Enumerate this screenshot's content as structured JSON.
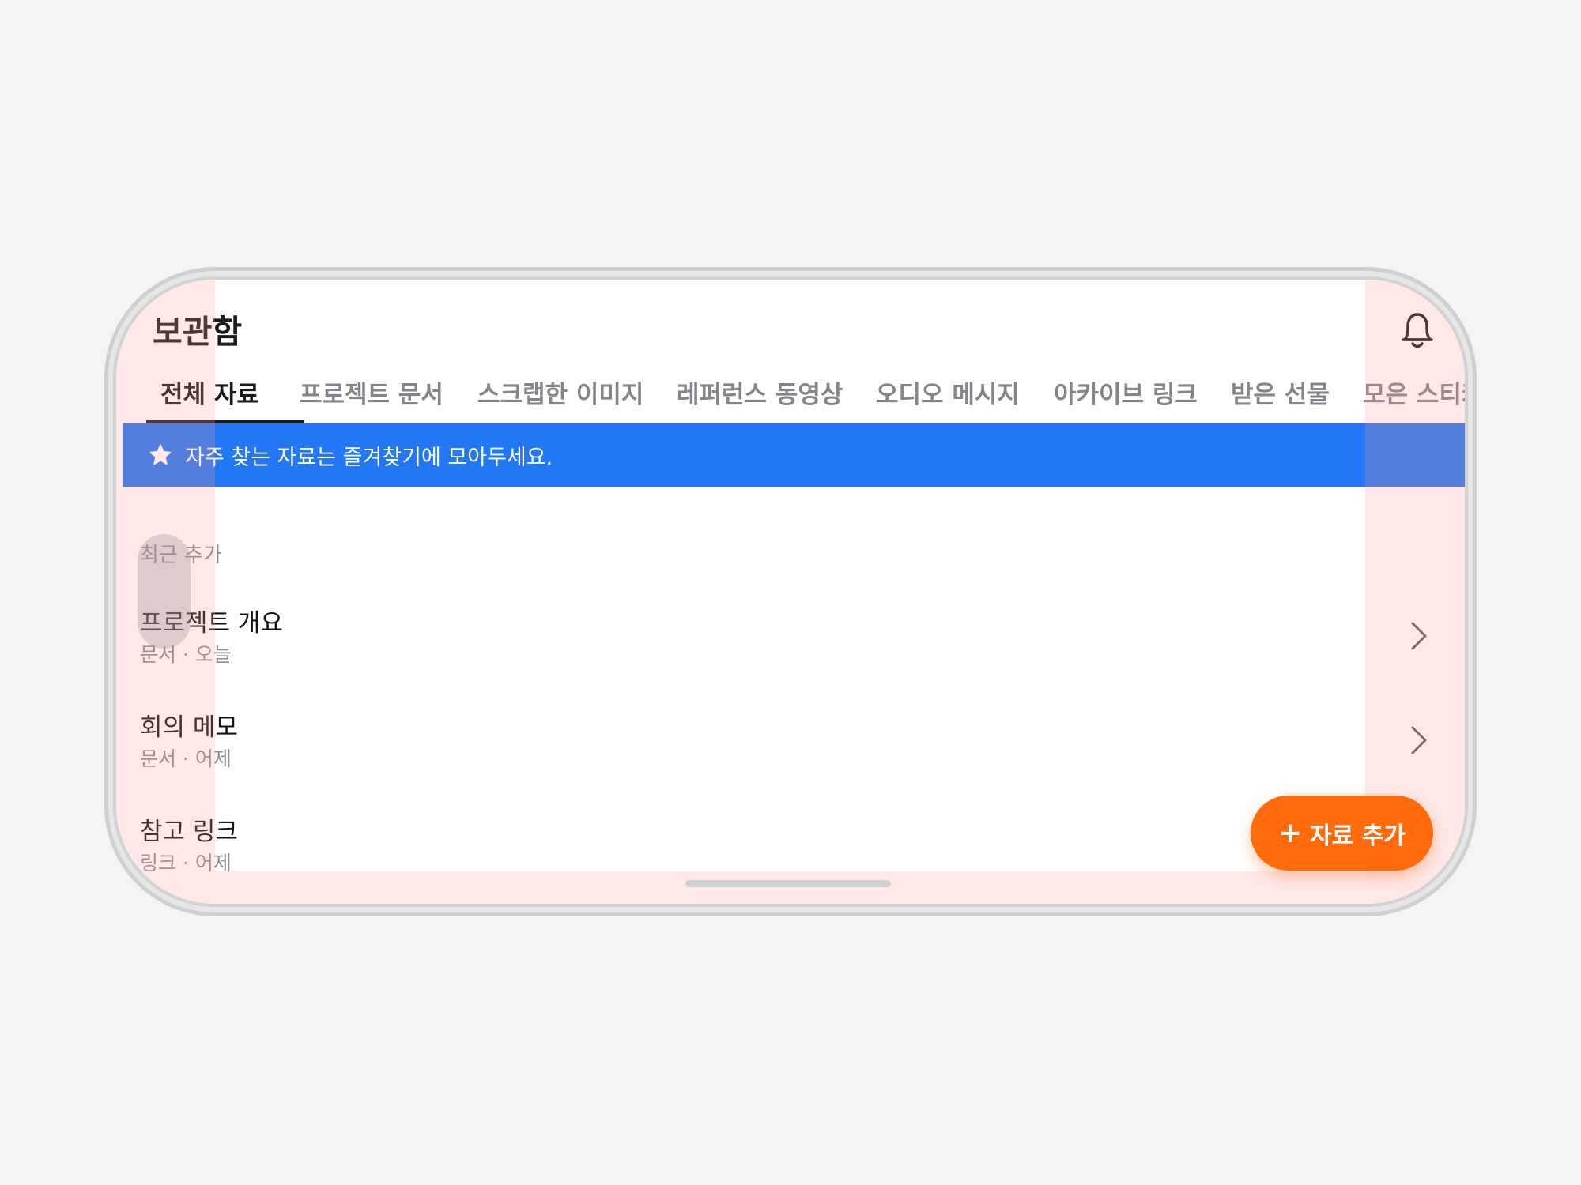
{
  "header": {
    "title": "보관함",
    "notification_icon": "bell-icon"
  },
  "tabs": [
    {
      "label": "전체 자료",
      "active": true
    },
    {
      "label": "프로젝트 문서",
      "active": false
    },
    {
      "label": "스크랩한 이미지",
      "active": false
    },
    {
      "label": "레퍼런스 동영상",
      "active": false
    },
    {
      "label": "오디오 메시지",
      "active": false
    },
    {
      "label": "아카이브 링크",
      "active": false
    },
    {
      "label": "받은 선물",
      "active": false
    },
    {
      "label": "모은 스티커",
      "active": false
    }
  ],
  "banner": {
    "icon": "star-icon",
    "text": "자주 찾는 자료는 즐겨찾기에 모아두세요.",
    "color": "#2378f5"
  },
  "section": {
    "label": "최근 추가"
  },
  "items": [
    {
      "title": "프로젝트 개요",
      "subtitle": "문서 · 오늘"
    },
    {
      "title": "회의 메모",
      "subtitle": "문서 · 어제"
    },
    {
      "title": "참고 링크",
      "subtitle": "링크 · 어제"
    }
  ],
  "fab": {
    "label": "자료 추가",
    "icon": "plus-icon",
    "color": "#ff6a0a"
  }
}
